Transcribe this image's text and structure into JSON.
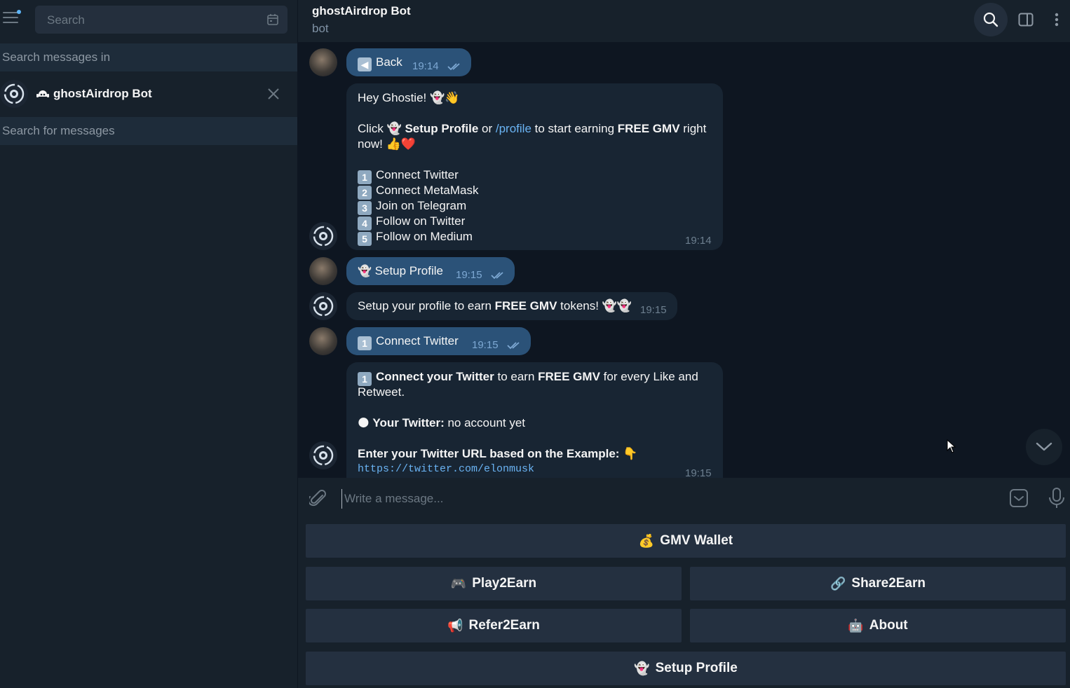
{
  "sidebar": {
    "search_placeholder": "Search",
    "search_messages_in": "Search messages in",
    "chat_name": "ghostAirdrop Bot",
    "search_for_messages": "Search for messages"
  },
  "header": {
    "title": "ghostAirdrop Bot",
    "subtitle": "bot"
  },
  "messages": {
    "m1": {
      "icon": "◀",
      "text": "Back",
      "time": "19:14"
    },
    "m2": {
      "greeting": "Hey Ghostie! 👻👋",
      "l1a": "Click 👻 ",
      "l1b": "Setup Profile",
      "l1c": " or ",
      "l1d": "/profile",
      "l1e": " to start earning ",
      "l1f": "FREE GMV",
      "l1g": " right",
      "l2": "now! 👍❤️",
      "steps": [
        "Connect Twitter",
        "Connect MetaMask",
        "Join on Telegram",
        "Follow on Twitter",
        "Follow on Medium"
      ],
      "nums": [
        "1",
        "2",
        "3",
        "4",
        "5"
      ],
      "time": "19:14"
    },
    "m3": {
      "icon": "👻",
      "text": "Setup Profile",
      "time": "19:15"
    },
    "m4": {
      "a": "Setup your profile to earn ",
      "b": "FREE GMV",
      "c": " tokens! 👻👻",
      "time": "19:15"
    },
    "m5": {
      "num": "1",
      "text": "Connect Twitter",
      "time": "19:15"
    },
    "m6": {
      "num": "1",
      "a": "Connect your Twitter",
      "b": " to earn ",
      "c": "FREE GMV",
      "d": " for every Like and",
      "e": "Retweet.",
      "f_icon": "🌑",
      "f_bold": "Your Twitter:",
      "f_rest": " no account yet",
      "g": "Enter your Twitter URL based on the Example: 👇",
      "url": "https://twitter.com/elonmusk",
      "time": "19:15"
    }
  },
  "composer": {
    "placeholder": "Write a message..."
  },
  "keyboard": {
    "wallet": {
      "icon": "💰",
      "label": "GMV Wallet"
    },
    "play": {
      "icon": "🎮",
      "label": "Play2Earn"
    },
    "share": {
      "icon": "🔗",
      "label": "Share2Earn"
    },
    "refer": {
      "icon": "📢",
      "label": "Refer2Earn"
    },
    "about": {
      "icon": "🤖",
      "label": "About"
    },
    "setup": {
      "icon": "👻",
      "label": "Setup Profile"
    }
  }
}
